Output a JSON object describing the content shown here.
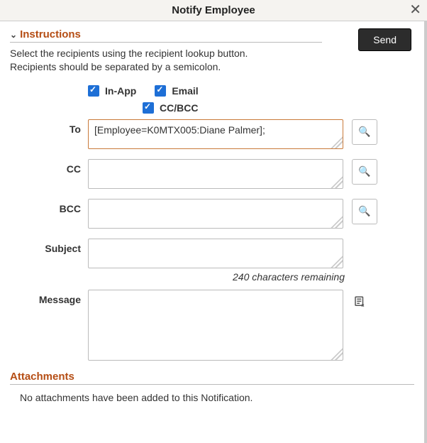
{
  "header": {
    "title": "Notify Employee"
  },
  "actions": {
    "send": "Send"
  },
  "instructions": {
    "heading": "Instructions",
    "line1": "Select the recipients using the recipient lookup button.",
    "line2": "Recipients should be separated by a semicolon."
  },
  "checkboxes": {
    "inapp_label": "In-App",
    "email_label": "Email",
    "ccbcc_label": "CC/BCC"
  },
  "fields": {
    "to": {
      "label": "To",
      "value": "[Employee=K0MTX005:Diane Palmer];"
    },
    "cc": {
      "label": "CC",
      "value": ""
    },
    "bcc": {
      "label": "BCC",
      "value": ""
    },
    "subject": {
      "label": "Subject",
      "value": "",
      "remaining": "240 characters remaining"
    },
    "message": {
      "label": "Message",
      "value": ""
    }
  },
  "attachments": {
    "heading": "Attachments",
    "empty": "No attachments have been added to this Notification."
  }
}
